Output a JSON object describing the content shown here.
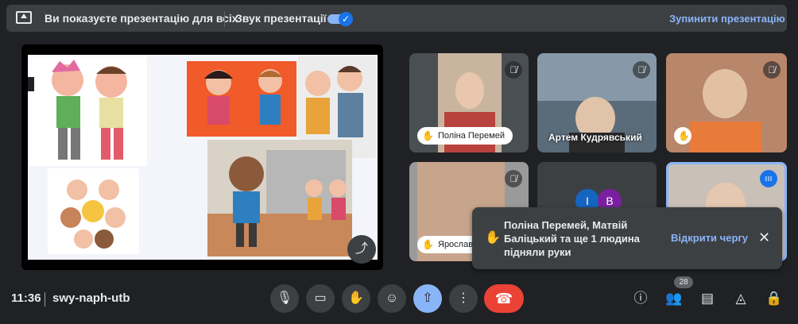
{
  "banner": {
    "text": "Ви показуєте презентацію для всіх",
    "sound_label": "Звук презентації",
    "sound_on": true,
    "stop_label": "Зупинити презентацію"
  },
  "tiles": [
    {
      "name": "Поліна Перемей",
      "hand_raised": true,
      "muted": true
    },
    {
      "name": "Артем Кудрявський",
      "hand_raised": false,
      "muted": true
    },
    {
      "name": "",
      "hand_raised": true,
      "muted": true
    },
    {
      "name": "Ярослав",
      "hand_raised": true,
      "muted": true
    },
    {
      "avatars": [
        "I",
        "B"
      ],
      "avatar_colors": [
        "#1565c0",
        "#7b1fa2"
      ]
    },
    {
      "name": "",
      "speaking": true
    }
  ],
  "toast": {
    "text": "Поліна Перемей, Матвій Баліцький та ще 1 людина підняли руки",
    "action": "Відкрити чергу"
  },
  "bottom": {
    "time": "11:36",
    "meeting_code": "swy-naph-utb",
    "participants_count": "28"
  },
  "colors": {
    "accent": "#8ab4f8",
    "end_call": "#ea4335",
    "present_active": "#8ab4f8"
  }
}
